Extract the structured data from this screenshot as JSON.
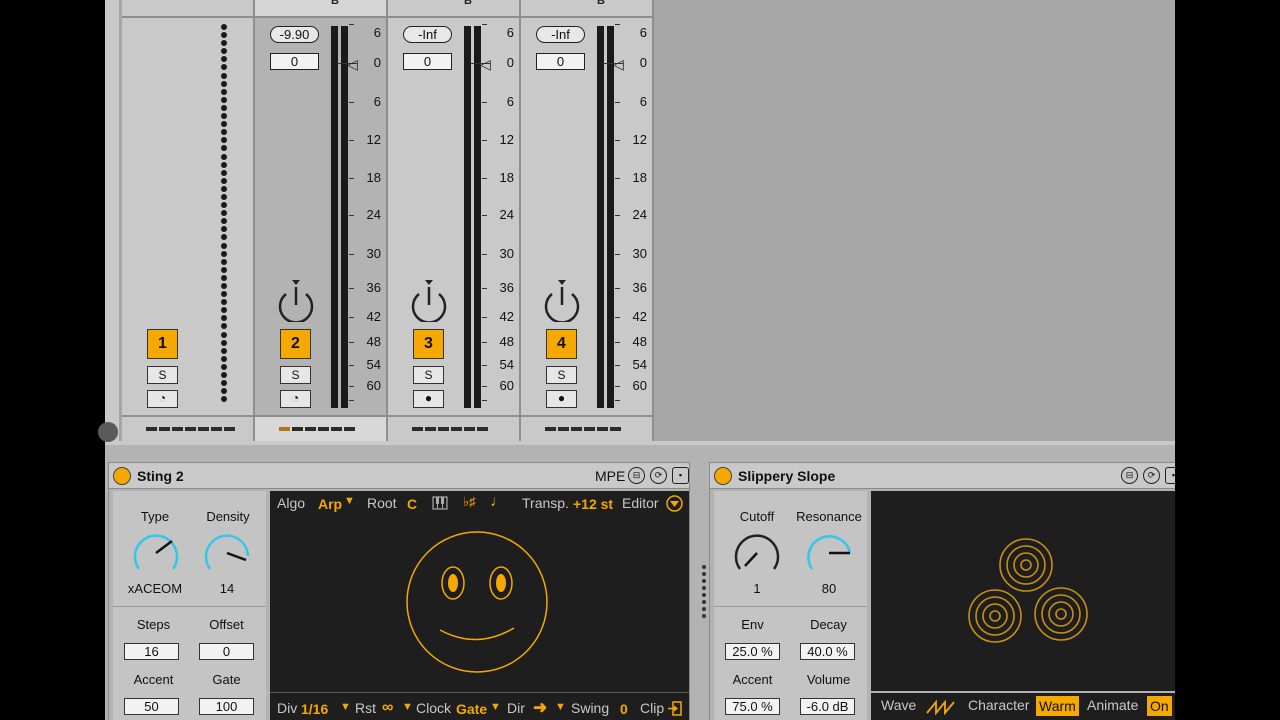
{
  "mixer": {
    "strips": [
      {
        "num": "1",
        "solo": "S",
        "mon": "◔"
      },
      {
        "num": "2",
        "peak": "-9.90",
        "vol": "0",
        "solo": "S",
        "mon": "◔"
      },
      {
        "num": "3",
        "peak": "-Inf",
        "vol": "0",
        "solo": "S",
        "mon": "●"
      },
      {
        "num": "4",
        "peak": "-Inf",
        "vol": "0",
        "solo": "S",
        "mon": "●"
      }
    ],
    "scale": [
      "6",
      "0",
      "6",
      "12",
      "18",
      "24",
      "30",
      "36",
      "42",
      "48",
      "54",
      "60"
    ],
    "b_glyph": "B"
  },
  "sting": {
    "title": "Sting 2",
    "mpe": "MPE",
    "type_label": "Type",
    "type_value": "xACEOM",
    "density_label": "Density",
    "density_value": "14",
    "steps_label": "Steps",
    "steps_value": "16",
    "offset_label": "Offset",
    "offset_value": "0",
    "accent_label": "Accent",
    "accent_value": "50",
    "gate_label": "Gate",
    "gate_value": "100",
    "screen": {
      "algo_label": "Algo",
      "algo_value": "Arp",
      "root_label": "Root",
      "root_value": "C",
      "transp_label": "Transp.",
      "transp_value": "+12 st",
      "editor_label": "Editor",
      "div_label": "Div",
      "div_value": "1/16",
      "rst_label": "Rst",
      "rst_value": "∞",
      "clock_label": "Clock",
      "clock_value": "Gate",
      "dir_label": "Dir",
      "swing_label": "Swing",
      "swing_value": "0",
      "clip_label": "Clip"
    }
  },
  "slope": {
    "title": "Slippery Slope",
    "cutoff_label": "Cutoff",
    "cutoff_value": "1",
    "resonance_label": "Resonance",
    "resonance_value": "80",
    "env_label": "Env",
    "env_value": "25.0 %",
    "decay_label": "Decay",
    "decay_value": "40.0 %",
    "accent_label": "Accent",
    "accent_value": "75.0 %",
    "volume_label": "Volume",
    "volume_value": "-6.0 dB",
    "wave_label": "Wave",
    "character_label": "Character",
    "character_value": "Warm",
    "animate_label": "Animate",
    "animate_value": "On"
  },
  "colors": {
    "accent": "#f5a800",
    "knob_arc": "#35c7e8",
    "panel": "#b3b3b3",
    "screen": "#1e1e1e"
  }
}
